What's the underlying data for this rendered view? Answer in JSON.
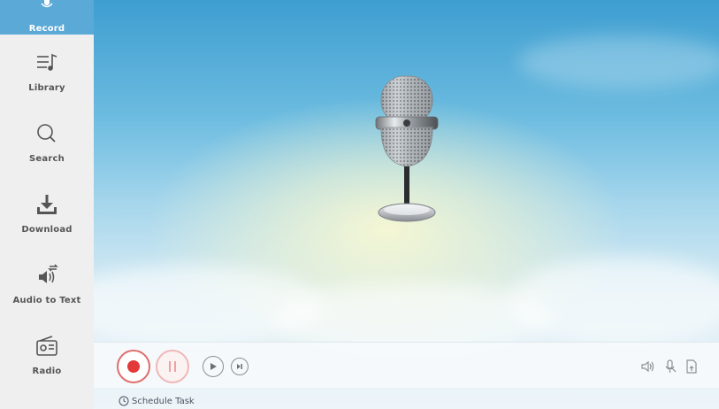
{
  "sidebar": {
    "items": [
      {
        "label": "Record",
        "icon": "mic-icon"
      },
      {
        "label": "Library",
        "icon": "music-list-icon"
      },
      {
        "label": "Search",
        "icon": "search-icon"
      },
      {
        "label": "Download",
        "icon": "download-icon"
      },
      {
        "label": "Audio to Text",
        "icon": "speaker-convert-icon"
      },
      {
        "label": "Radio",
        "icon": "radio-icon"
      }
    ],
    "active_color": "#5aa9d6"
  },
  "controls": {
    "record_icon": "record-icon",
    "pause_icon": "pause-icon",
    "play_icon": "play-icon",
    "next_icon": "skip-next-icon",
    "right_icons": [
      "speaker-icon",
      "mic-muted-icon",
      "file-icon"
    ]
  },
  "schedule": {
    "label": "Schedule Task",
    "icon": "clock-icon"
  },
  "colors": {
    "record_red": "#e23a3a",
    "sidebar_bg": "#efefef"
  }
}
